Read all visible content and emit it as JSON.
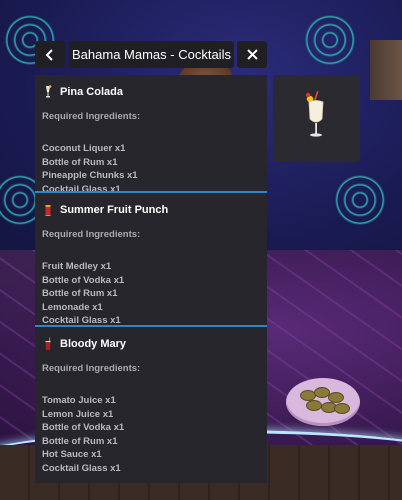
{
  "header": {
    "title": "Bahama Mamas - Cocktails",
    "back_icon": "chevron-left-icon",
    "close_icon": "close-icon"
  },
  "recipes": [
    {
      "name": "Pina Colada",
      "icon": "pina-colada-glass-icon",
      "required_label": "Required Ingredients:",
      "ingredients": [
        "Coconut Liquer x1",
        "Bottle of Rum x1",
        "Pineapple Chunks x1",
        "Cocktail Glass x1"
      ]
    },
    {
      "name": "Summer Fruit Punch",
      "icon": "fruit-punch-glass-icon",
      "required_label": "Required Ingredients:",
      "ingredients": [
        "Fruit Medley x1",
        "Bottle of Vodka x1",
        "Bottle of Rum x1",
        "Lemonade x1",
        "Cocktail Glass x1"
      ]
    },
    {
      "name": "Bloody Mary",
      "icon": "bloody-mary-glass-icon",
      "required_label": "Required Ingredients:",
      "ingredients": [
        "Tomato Juice x1",
        "Lemon Juice x1",
        "Bottle of Vodka x1",
        "Bottle of Rum x1",
        "Hot Sauce x1",
        "Cocktail Glass x1"
      ]
    }
  ],
  "preview": {
    "icon": "pina-colada-glass-icon"
  },
  "colors": {
    "panel": "#26262c",
    "divider": "#2e86c8",
    "text": "#b9b9c0"
  }
}
